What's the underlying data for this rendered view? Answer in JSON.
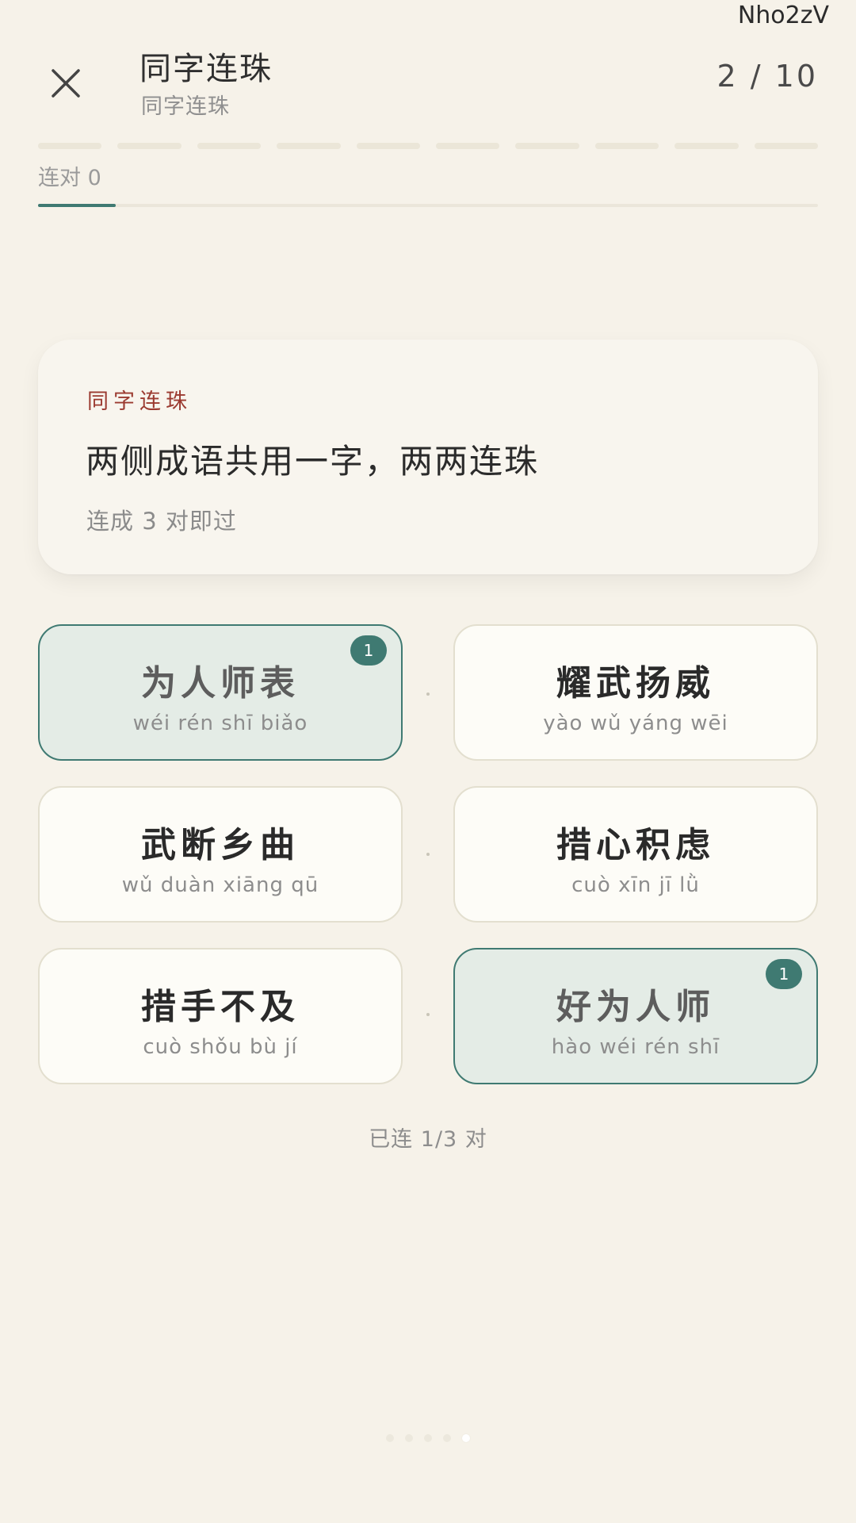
{
  "watermark": "Nho2zV",
  "header": {
    "title": "同字连珠",
    "subtitle": "同字连珠",
    "counter": "2 / 10",
    "close_icon": "close-icon"
  },
  "progress": {
    "segments_total": 10,
    "pairs_label": "连对 0",
    "track_fraction": 0.1
  },
  "card": {
    "tag": "同字连珠",
    "title": "两侧成语共用一字，两两连珠",
    "note": "连成 3 对即过"
  },
  "tiles": {
    "left": [
      {
        "idiom": "为人师表",
        "pinyin": "wéi rén shī biǎo",
        "selected": true,
        "badge": "1"
      },
      {
        "idiom": "武断乡曲",
        "pinyin": "wǔ duàn xiāng qū",
        "selected": false
      },
      {
        "idiom": "措手不及",
        "pinyin": "cuò shǒu bù jí",
        "selected": false
      }
    ],
    "right": [
      {
        "idiom": "耀武扬威",
        "pinyin": "yào wǔ yáng wēi",
        "selected": false
      },
      {
        "idiom": "措心积虑",
        "pinyin": "cuò xīn jī lǜ",
        "selected": false
      },
      {
        "idiom": "好为人师",
        "pinyin": "hào wéi rén shī",
        "selected": true,
        "badge": "1"
      }
    ]
  },
  "status": "已连 1/3 对",
  "pager": {
    "count": 5,
    "active_index": 4
  },
  "colors": {
    "background": "#f6f2e9",
    "accent": "#3f7a72",
    "tag_red": "#9b3a30",
    "selected_tile": "#e4ece6"
  }
}
